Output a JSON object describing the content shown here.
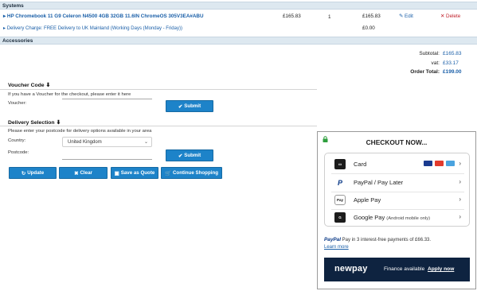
{
  "systems": {
    "heading": "Systems",
    "product": {
      "name": "HP Chromebook 11 G9 Celeron N4500 4GB 32GB 11.6IN ChromeOS 305V3EA#ABU",
      "unit_price": "£165.83",
      "qty": "1",
      "total": "£165.83",
      "edit": "Edit",
      "delete": "Delete"
    },
    "delivery": {
      "label": "Delivery Charge: FREE Delivery to UK Mainland (Working Days (Monday - Friday))",
      "price": "£0.00"
    }
  },
  "accessories": {
    "heading": "Accessories"
  },
  "totals": {
    "subtotal_label": "Subtotal:",
    "subtotal": "£165.83",
    "vat_label": "vat:",
    "vat": "£33.17",
    "order_label": "Order Total:",
    "order": "£199.00"
  },
  "voucher": {
    "heading": "Voucher Code",
    "hint": "If you have a Voucher for the checkout, please enter it here",
    "label": "Voucher:",
    "value": "",
    "submit": "Submit"
  },
  "delivery_selection": {
    "heading": "Delivery Selection",
    "hint": "Please enter your postcode for delivery options available in your area",
    "country_label": "Country:",
    "country": "United Kingdom",
    "postcode_label": "Postcode:",
    "postcode": "",
    "submit": "Submit"
  },
  "actions": {
    "update": "Update",
    "clear": "Clear",
    "save_quote": "Save as Quote",
    "continue": "Continue Shopping"
  },
  "checkout": {
    "title": "CHECKOUT NOW...",
    "methods": [
      {
        "label": "Card",
        "note": "",
        "icon": "card-icon"
      },
      {
        "label": "PayPal / Pay Later",
        "note": "",
        "icon": "paypal-icon"
      },
      {
        "label": "Apple Pay",
        "note": "",
        "icon": "apple-pay-icon"
      },
      {
        "label": "Google Pay",
        "note": "(Android mobile only)",
        "icon": "google-pay-icon"
      }
    ],
    "paypal_logo": "PayPal",
    "paypal_note": "Pay in 3 interest-free payments of £66.33.",
    "learn_more": "Learn more",
    "newpay_logo": "newpay",
    "newpay_text": "Finance available",
    "newpay_link": "Apply now"
  },
  "colors": {
    "accent": "#1d83c9",
    "link": "#1a5fa8",
    "danger": "#c0202a",
    "newpay_bg": "#0e2340"
  }
}
